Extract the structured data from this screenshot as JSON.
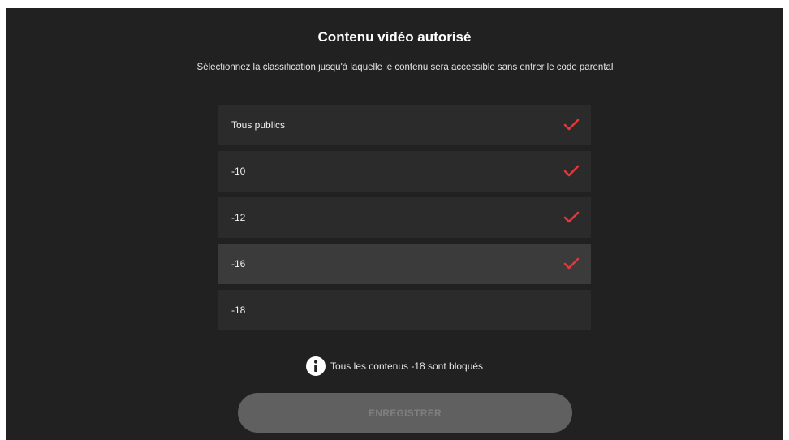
{
  "dialog": {
    "title": "Contenu vidéo autorisé",
    "subtitle": "Sélectionnez la classification jusqu'à laquelle le contenu sera accessible sans entrer le code parental"
  },
  "options": [
    {
      "label": "Tous publics",
      "checked": true,
      "highlighted": false
    },
    {
      "label": "-10",
      "checked": true,
      "highlighted": false
    },
    {
      "label": "-12",
      "checked": true,
      "highlighted": false
    },
    {
      "label": "-16",
      "checked": true,
      "highlighted": true
    },
    {
      "label": "-18",
      "checked": false,
      "highlighted": false
    }
  ],
  "info": {
    "icon": "info-icon",
    "text": "Tous les contenus -18 sont bloqués"
  },
  "save_button": {
    "label": "ENREGISTRER",
    "enabled": false
  },
  "colors": {
    "background": "#212121",
    "row": "#2b2b2b",
    "row_selected": "#3b3b3b",
    "check": "#e8363a",
    "button_disabled": "#606060",
    "button_text_disabled": "#7f7f7f"
  },
  "icons": {
    "check": "check-icon"
  }
}
